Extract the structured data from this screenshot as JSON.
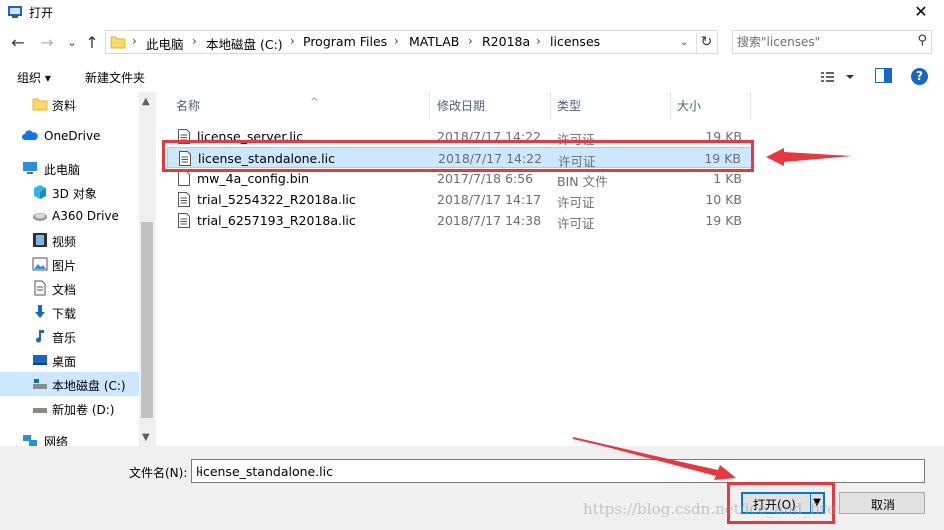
{
  "window": {
    "title": "打开",
    "close_glyph": "✕"
  },
  "nav": {
    "back_glyph": "←",
    "forward_glyph": "→",
    "recent_glyph": "⌄",
    "up_glyph": "↑",
    "breadcrumb": [
      "此电脑",
      "本地磁盘 (C:)",
      "Program Files",
      "MATLAB",
      "R2018a",
      "licenses"
    ],
    "search_placeholder": "搜索\"licenses\""
  },
  "toolbar": {
    "organize": "组织 ▾",
    "new_folder": "新建文件夹"
  },
  "sidebar": {
    "items": [
      {
        "label": "资料",
        "icon": "folder-icon"
      },
      {
        "label": "OneDrive",
        "icon": "cloud-icon"
      },
      {
        "label": "此电脑",
        "icon": "computer-icon"
      },
      {
        "label": "3D 对象",
        "icon": "cube-icon"
      },
      {
        "label": "A360 Drive",
        "icon": "drive-icon"
      },
      {
        "label": "视频",
        "icon": "video-icon"
      },
      {
        "label": "图片",
        "icon": "picture-icon"
      },
      {
        "label": "文档",
        "icon": "document-icon"
      },
      {
        "label": "下载",
        "icon": "download-icon"
      },
      {
        "label": "音乐",
        "icon": "music-icon"
      },
      {
        "label": "桌面",
        "icon": "desktop-icon"
      },
      {
        "label": "本地磁盘 (C:)",
        "icon": "disk-icon"
      },
      {
        "label": "新加卷 (D:)",
        "icon": "disk-icon"
      },
      {
        "label": "网络",
        "icon": "network-icon"
      }
    ]
  },
  "columns": {
    "name": "名称",
    "date": "修改日期",
    "type": "类型",
    "size": "大小"
  },
  "files": [
    {
      "name": "license_server.lic",
      "date": "2018/7/17 14:22",
      "type": "许可证",
      "size": "19 KB"
    },
    {
      "name": "license_standalone.lic",
      "date": "2018/7/17 14:22",
      "type": "许可证",
      "size": "19 KB"
    },
    {
      "name": "mw_4a_config.bin",
      "date": "2017/7/18 6:56",
      "type": "BIN 文件",
      "size": "1 KB"
    },
    {
      "name": "trial_5254322_R2018a.lic",
      "date": "2018/7/17 14:17",
      "type": "许可证",
      "size": "10 KB"
    },
    {
      "name": "trial_6257193_R2018a.lic",
      "date": "2018/7/17 14:38",
      "type": "许可证",
      "size": "19 KB"
    }
  ],
  "selected_file_index": 1,
  "footer": {
    "filename_label": "文件名(N):",
    "filename_value": "license_standalone.lic",
    "open_label": "打开(O)",
    "cancel_label": "取消"
  },
  "watermark": "https://blog.csdn.net/ice_and_fire",
  "colors": {
    "annotation": "#e8373e",
    "selection": "#cce8ff",
    "accent": "#0078d7"
  }
}
